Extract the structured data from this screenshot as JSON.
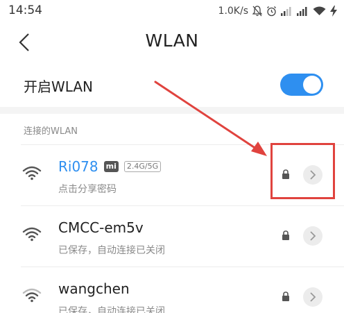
{
  "status_bar": {
    "time": "14:54",
    "net_speed": "1.0K/s",
    "icons": [
      "mute-icon",
      "alarm-icon",
      "signal-icon",
      "signal-icon",
      "wifi-icon",
      "battery-charging-icon"
    ]
  },
  "nav": {
    "title": "WLAN",
    "back_icon": "back-chevron-icon"
  },
  "wlan_toggle": {
    "label": "开启WLAN",
    "on": true
  },
  "connected_section": {
    "header": "连接的WLAN"
  },
  "networks": [
    {
      "name": "Ri078",
      "subtitle": "点击分享密码",
      "connected": true,
      "badges": [
        "mi",
        "2.4G/5G"
      ],
      "secured": true
    },
    {
      "name": "CMCC-em5v",
      "subtitle": "已保存，自动连接已关闭",
      "connected": false,
      "secured": true
    },
    {
      "name": "wangchen",
      "subtitle": "已保存，自动连接已关闭",
      "connected": false,
      "secured": true
    }
  ],
  "badges": {
    "mi": "mi",
    "band": "2.4G/5G"
  },
  "colors": {
    "accent": "#2e8ff0",
    "annotation": "#e0433e"
  }
}
